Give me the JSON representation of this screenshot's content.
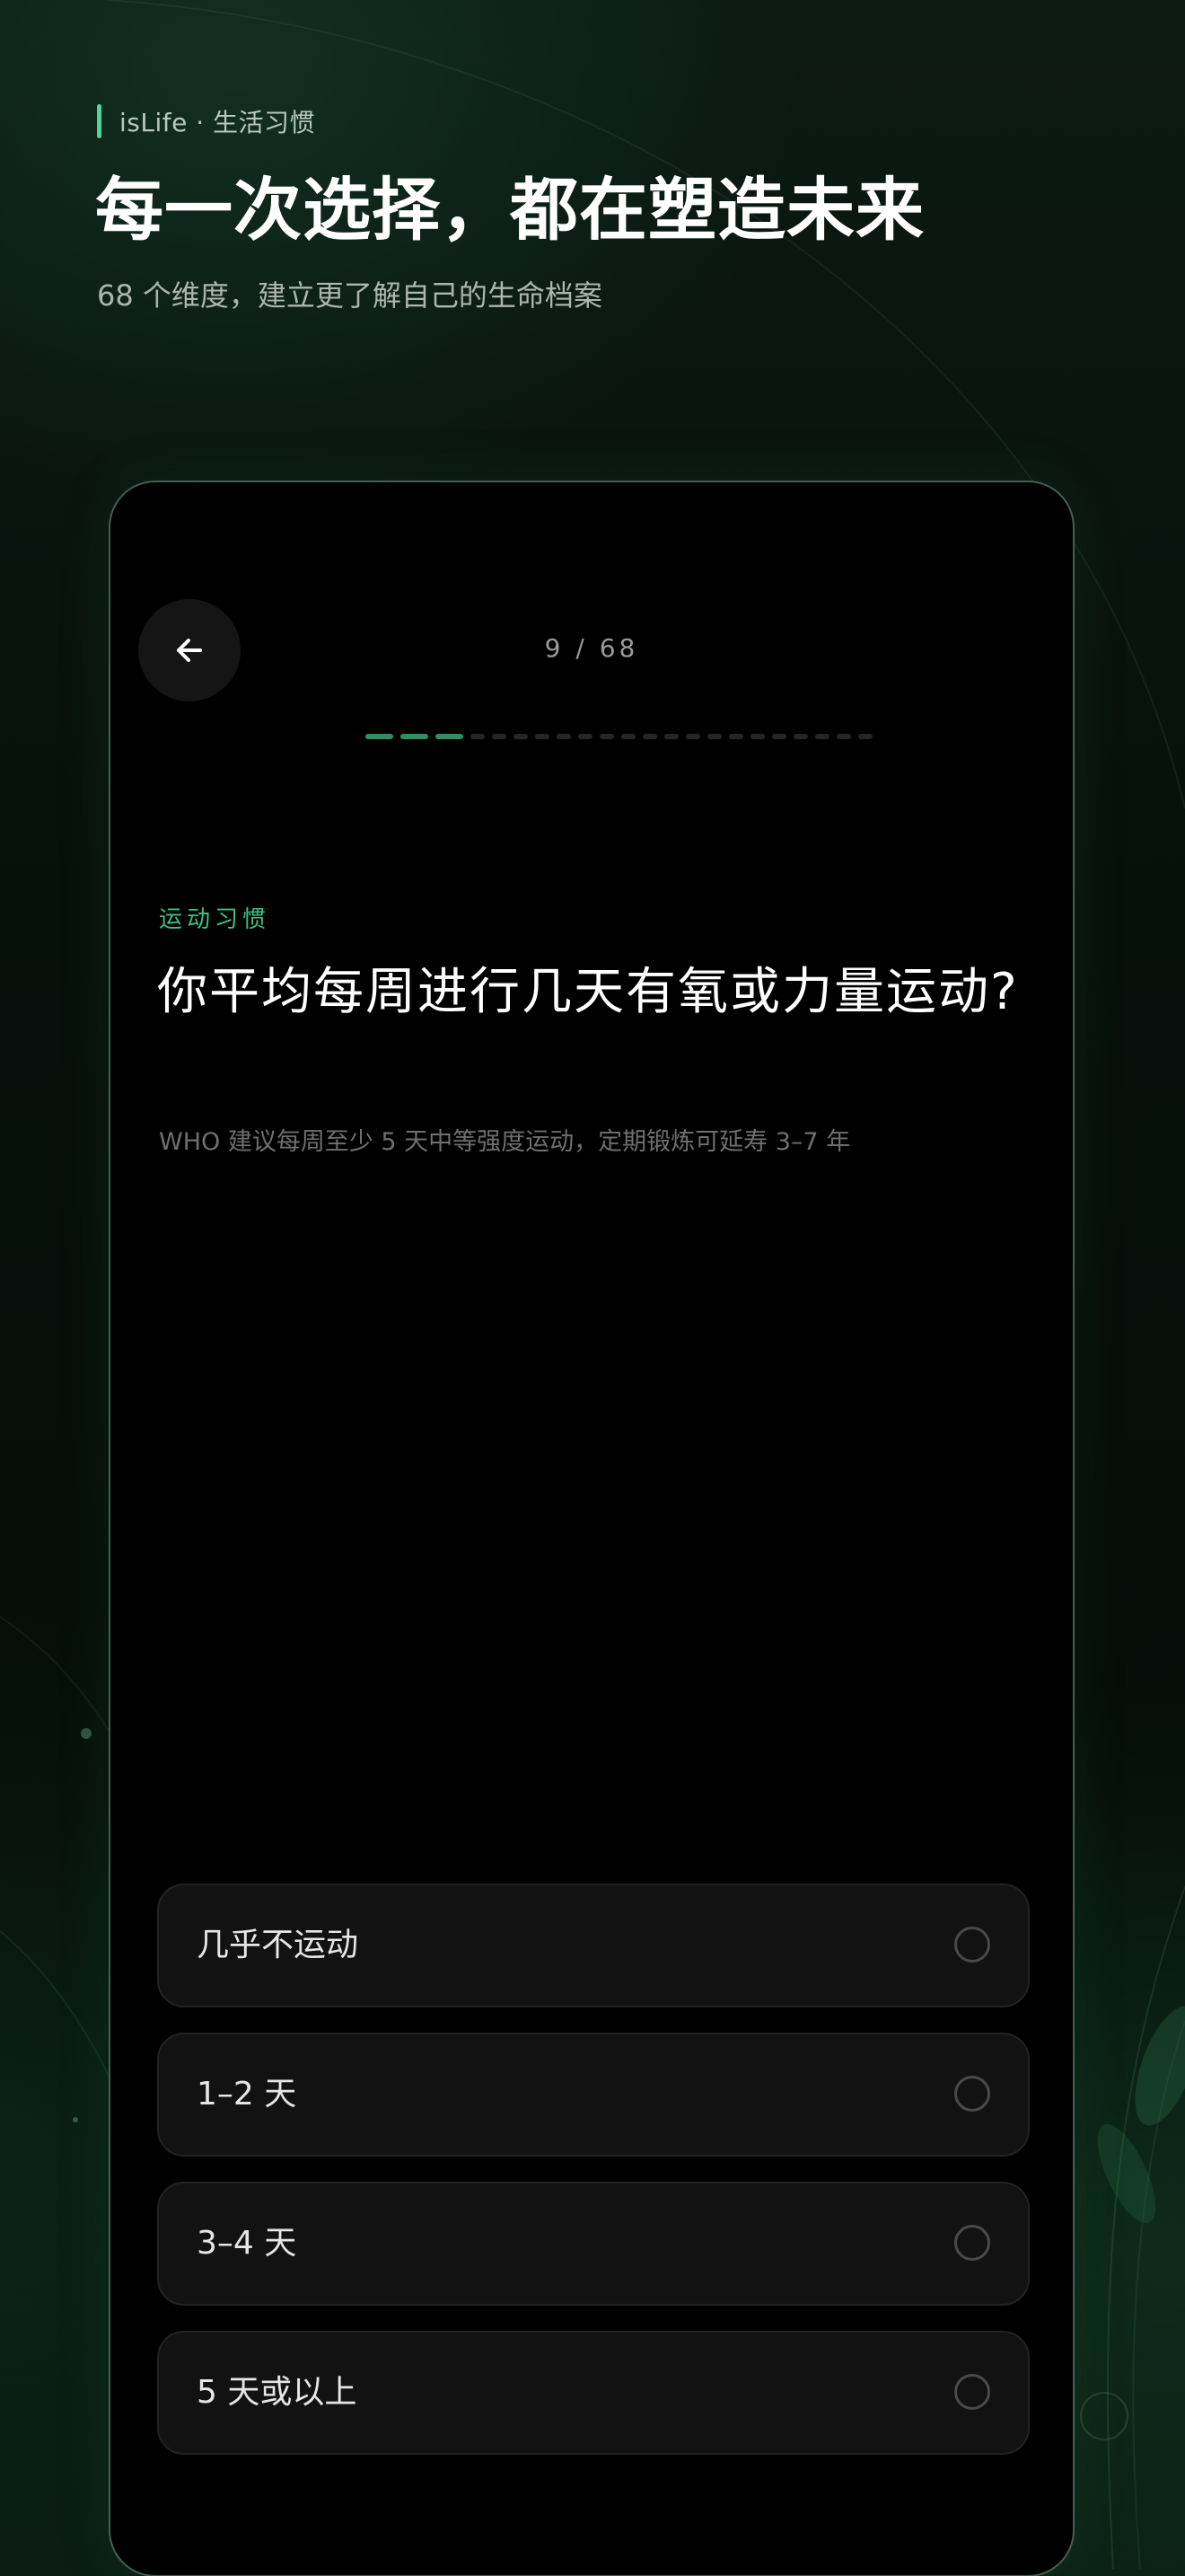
{
  "header": {
    "brand": "isLife · 生活习惯",
    "title": "每一次选择，都在塑造未来",
    "subtitle": "68 个维度，建立更了解自己的生命档案"
  },
  "quiz": {
    "counter": "9 / 68",
    "progress": {
      "current": 9,
      "total": 68,
      "segments_completed": 3,
      "segments_total": 22
    },
    "category": "运动习惯",
    "question": "你平均每周进行几天有氧或力量运动?",
    "hint": "WHO 建议每周至少 5 天中等强度运动，定期锻炼可延寿 3–7 年",
    "options": [
      {
        "label": "几乎不运动",
        "selected": false
      },
      {
        "label": "1–2 天",
        "selected": false
      },
      {
        "label": "3–4 天",
        "selected": false
      },
      {
        "label": "5 天或以上",
        "selected": false
      }
    ]
  },
  "icons": {
    "back": "arrow-left-icon",
    "option_radio": "radio-unchecked-icon"
  },
  "colors": {
    "accent": "#4fd69a",
    "category": "#3fbf85",
    "progress_done": "#2e8f63",
    "progress_todo": "#262626",
    "phone_background": "#000000"
  }
}
